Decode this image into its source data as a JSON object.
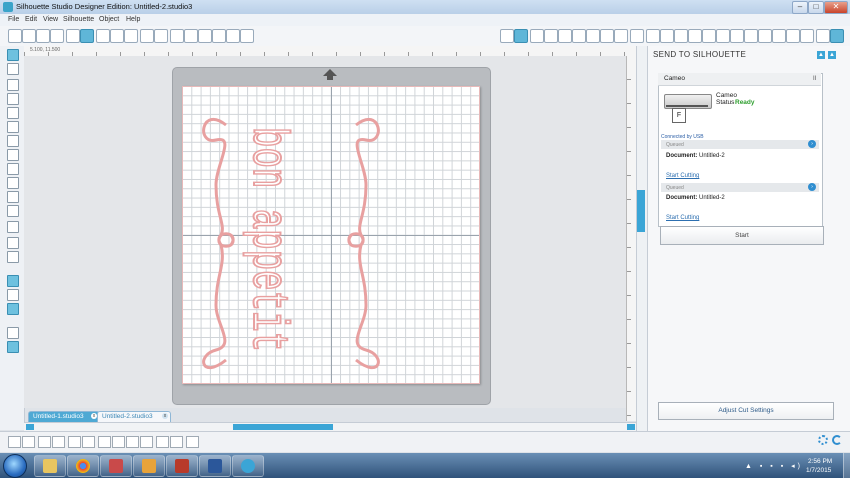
{
  "window": {
    "title": "Silhouette Studio Designer Edition: Untitled-2.studio3"
  },
  "menu": {
    "items": [
      "File",
      "Edit",
      "View",
      "Silhouette",
      "Object",
      "Help"
    ]
  },
  "ruler": {
    "coords": "5.100, 11.500"
  },
  "canvas": {
    "artwork_text": "bon appetit"
  },
  "tabs": [
    {
      "label": "Untitled-1.studio3",
      "active": true
    },
    {
      "label": "Untitled-2.studio3",
      "active": false
    }
  ],
  "panel": {
    "title": "SEND TO SILHOUETTE",
    "device_name": "Cameo",
    "model_label": "Cameo",
    "status_label": "Status",
    "status_value": "Ready",
    "connection": "Connected by USB",
    "queue": [
      {
        "label": "Queued",
        "doc_label": "Document:",
        "doc_value": "Untitled-2",
        "action": "Start Cutting"
      },
      {
        "label": "Queued",
        "doc_label": "Document:",
        "doc_value": "Untitled-2",
        "action": "Start Cutting"
      }
    ],
    "start_label": "Start",
    "adjust_label": "Adjust Cut Settings"
  },
  "taskbar": {
    "time": "2:56 PM",
    "date": "1/7/2015"
  },
  "colors": {
    "accent": "#3ba5d6",
    "artwork": "#e8a0a0",
    "status_ready": "#2e9e2e"
  }
}
